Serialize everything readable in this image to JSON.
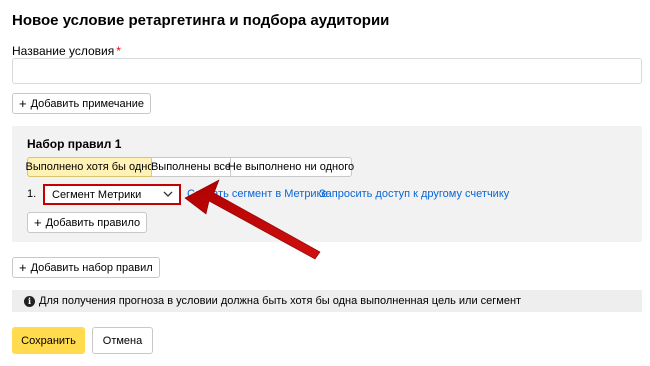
{
  "page": {
    "title": "Новое условие ретаргетинга и подбора аудитории"
  },
  "condition_name": {
    "label": "Название условия",
    "required_mark": "*",
    "value": ""
  },
  "add_note_label": "Добавить примечание",
  "ruleset": {
    "title": "Набор правил 1",
    "modes": [
      "Выполнено хотя бы одно",
      "Выполнены все",
      "Не выполнено ни одного"
    ],
    "active_mode": "Выполнено хотя бы одно",
    "rules": [
      {
        "number": "1.",
        "type": "Сегмент Метрики",
        "links": [
          "Создать сегмент в Метрике",
          "Запросить доступ к другому счетчику"
        ]
      }
    ],
    "add_rule_label": "Добавить правило"
  },
  "add_ruleset_label": "Добавить набор правил",
  "info_text": "Для получения прогноза в условии должна быть хотя бы одна выполненная цель или сегмент",
  "actions": {
    "save": "Сохранить",
    "cancel": "Отмена"
  },
  "colors": {
    "accent_yellow": "#ffdb4d",
    "active_segment": "#fff2b4",
    "link_blue": "#0a66d6",
    "annotation_red": "#c40000",
    "panel_gray": "#f2f2f2"
  },
  "icons": {
    "add": "plus-icon",
    "dropdown": "chevron-down-icon",
    "info": "info-icon",
    "annotation": "red-arrow"
  }
}
